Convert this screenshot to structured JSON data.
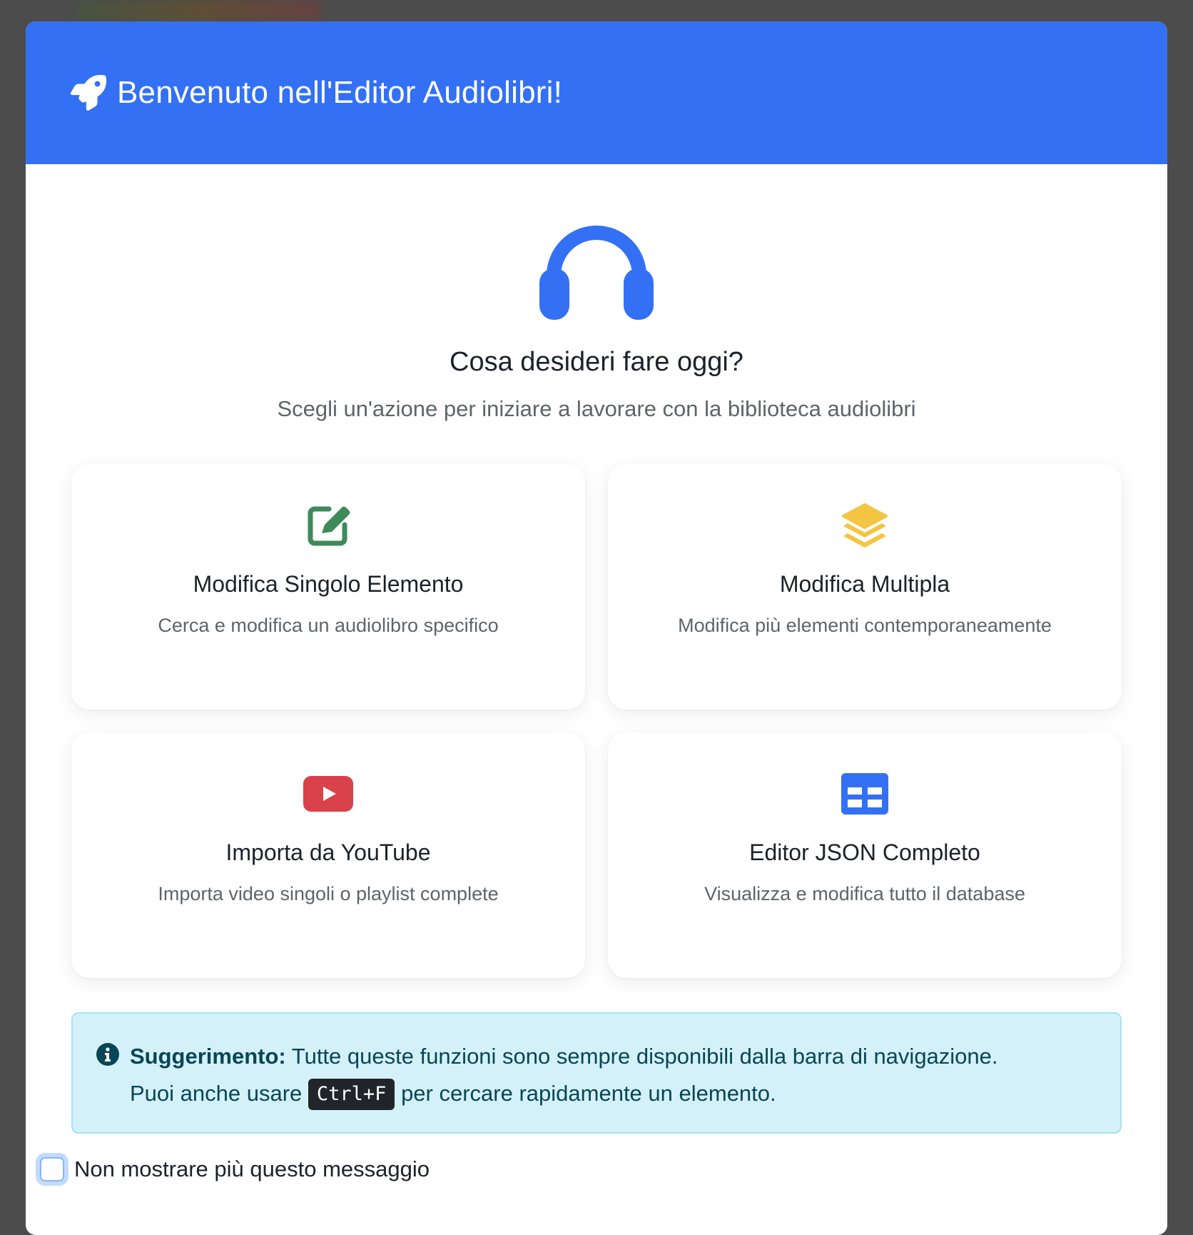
{
  "modal": {
    "title": "Benvenuto nell'Editor Audiolibri!",
    "header_icon": "rocket-icon",
    "accent_color": "#3370f4"
  },
  "hero": {
    "icon": "headphones-icon",
    "heading": "Cosa desideri fare oggi?",
    "subheading": "Scegli un'azione per iniziare a lavorare con la biblioteca audiolibri"
  },
  "actions": [
    {
      "icon": "edit-icon",
      "icon_color": "#3f8a5b",
      "title": "Modifica Singolo Elemento",
      "description": "Cerca e modifica un audiolibro specifico"
    },
    {
      "icon": "layers-icon",
      "icon_color": "#f3c542",
      "title": "Modifica Multipla",
      "description": "Modifica più elementi contemporaneamente"
    },
    {
      "icon": "youtube-icon",
      "icon_color": "#d9424b",
      "title": "Importa da YouTube",
      "description": "Importa video singoli o playlist complete"
    },
    {
      "icon": "table-icon",
      "icon_color": "#3370f4",
      "title": "Editor JSON Completo",
      "description": "Visualizza e modifica tutto il database"
    }
  ],
  "tip": {
    "icon": "info-icon",
    "label": "Suggerimento:",
    "text1": " Tutte queste funzioni sono sempre disponibili dalla barra di navigazione.",
    "text2_before": "Puoi anche usare ",
    "shortcut": "Ctrl+F",
    "text2_after": " per cercare rapidamente un elemento."
  },
  "dont_show": {
    "label": "Non mostrare più questo messaggio",
    "checked": false
  }
}
